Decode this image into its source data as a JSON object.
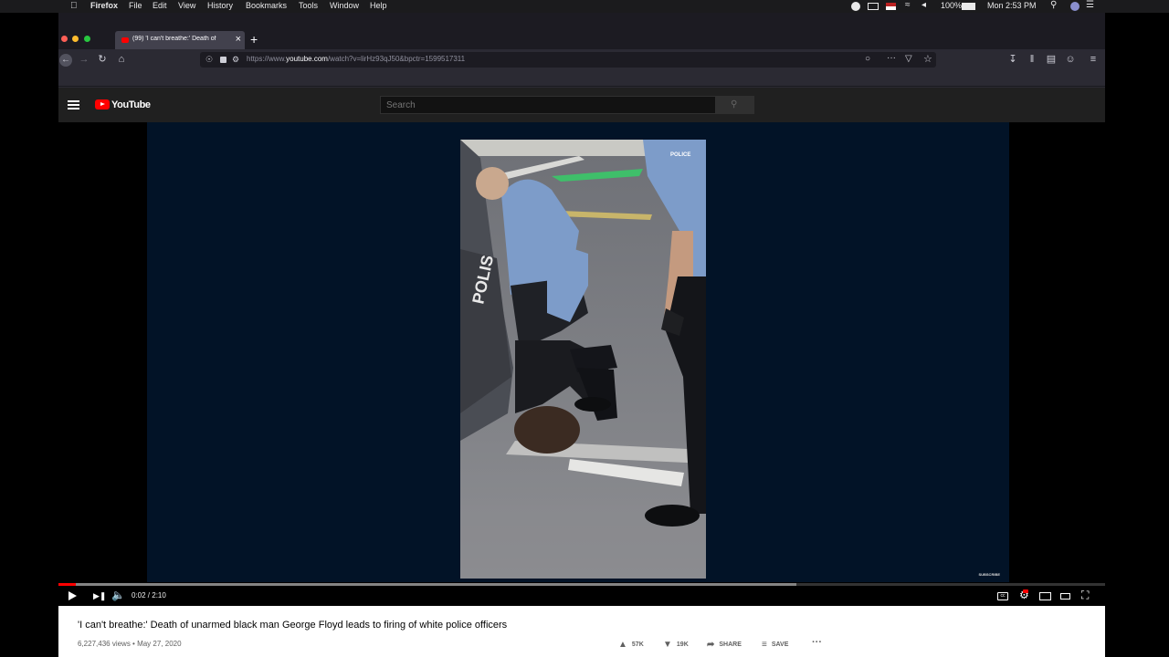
{
  "menubar": {
    "app": "Firefox",
    "items": [
      "File",
      "Edit",
      "View",
      "History",
      "Bookmarks",
      "Tools",
      "Window",
      "Help"
    ],
    "battery": "100%",
    "clock": "Mon 2:53 PM"
  },
  "browser": {
    "tab_title": "(99) 'I can't breathe:' Death of",
    "url_prefix": "https://www.",
    "url_host": "youtube.com",
    "url_path": "/watch?v=lirHz93qJ50&bpctr=1599517311"
  },
  "youtube": {
    "logo_text": "YouTube",
    "search_placeholder": "Search"
  },
  "player": {
    "current_time": "0:02",
    "duration": "2:10",
    "time_display": "0:02 / 2:10",
    "played_fraction": 0.017,
    "buffered_fraction": 0.705,
    "watermark": "SUBSCRIBE",
    "video_decal_text": "POLIS",
    "patch_text": "POLICE"
  },
  "video_info": {
    "title": "'I can't breathe:' Death of unarmed black man George Floyd leads to firing of white police officers",
    "meta": "6,227,436 views • May 27, 2020",
    "likes": "57K",
    "dislikes": "19K",
    "share": "SHARE",
    "save": "SAVE"
  },
  "colors": {
    "youtube_red": "#ff0000",
    "player_backdrop": "#021327",
    "toolbar": "#2b2a33"
  }
}
